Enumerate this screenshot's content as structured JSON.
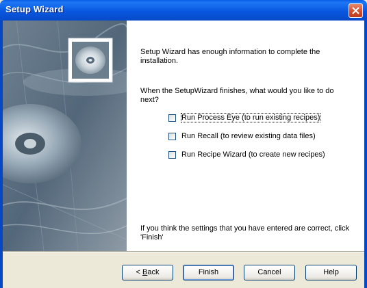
{
  "window": {
    "title": "Setup Wizard"
  },
  "content": {
    "intro": "Setup Wizard has enough information to complete the installation.",
    "question": "When the SetupWizard finishes, what would you like to do next?",
    "options": [
      {
        "label": "Run Process Eye (to run existing recipes)",
        "checked": false
      },
      {
        "label": "Run Recall (to review existing data files)",
        "checked": false
      },
      {
        "label": "Run Recipe Wizard (to create new recipes)",
        "checked": false
      }
    ],
    "footer": "If you think the settings that you have entered are correct, click 'Finish'"
  },
  "buttons": {
    "back_prefix": "< ",
    "back_key": "B",
    "back_rest": "ack",
    "finish": "Finish",
    "cancel": "Cancel",
    "help": "Help"
  },
  "colors": {
    "titlebar": "#0957e0",
    "close": "#d2502f",
    "dialog": "#ece9d8"
  }
}
